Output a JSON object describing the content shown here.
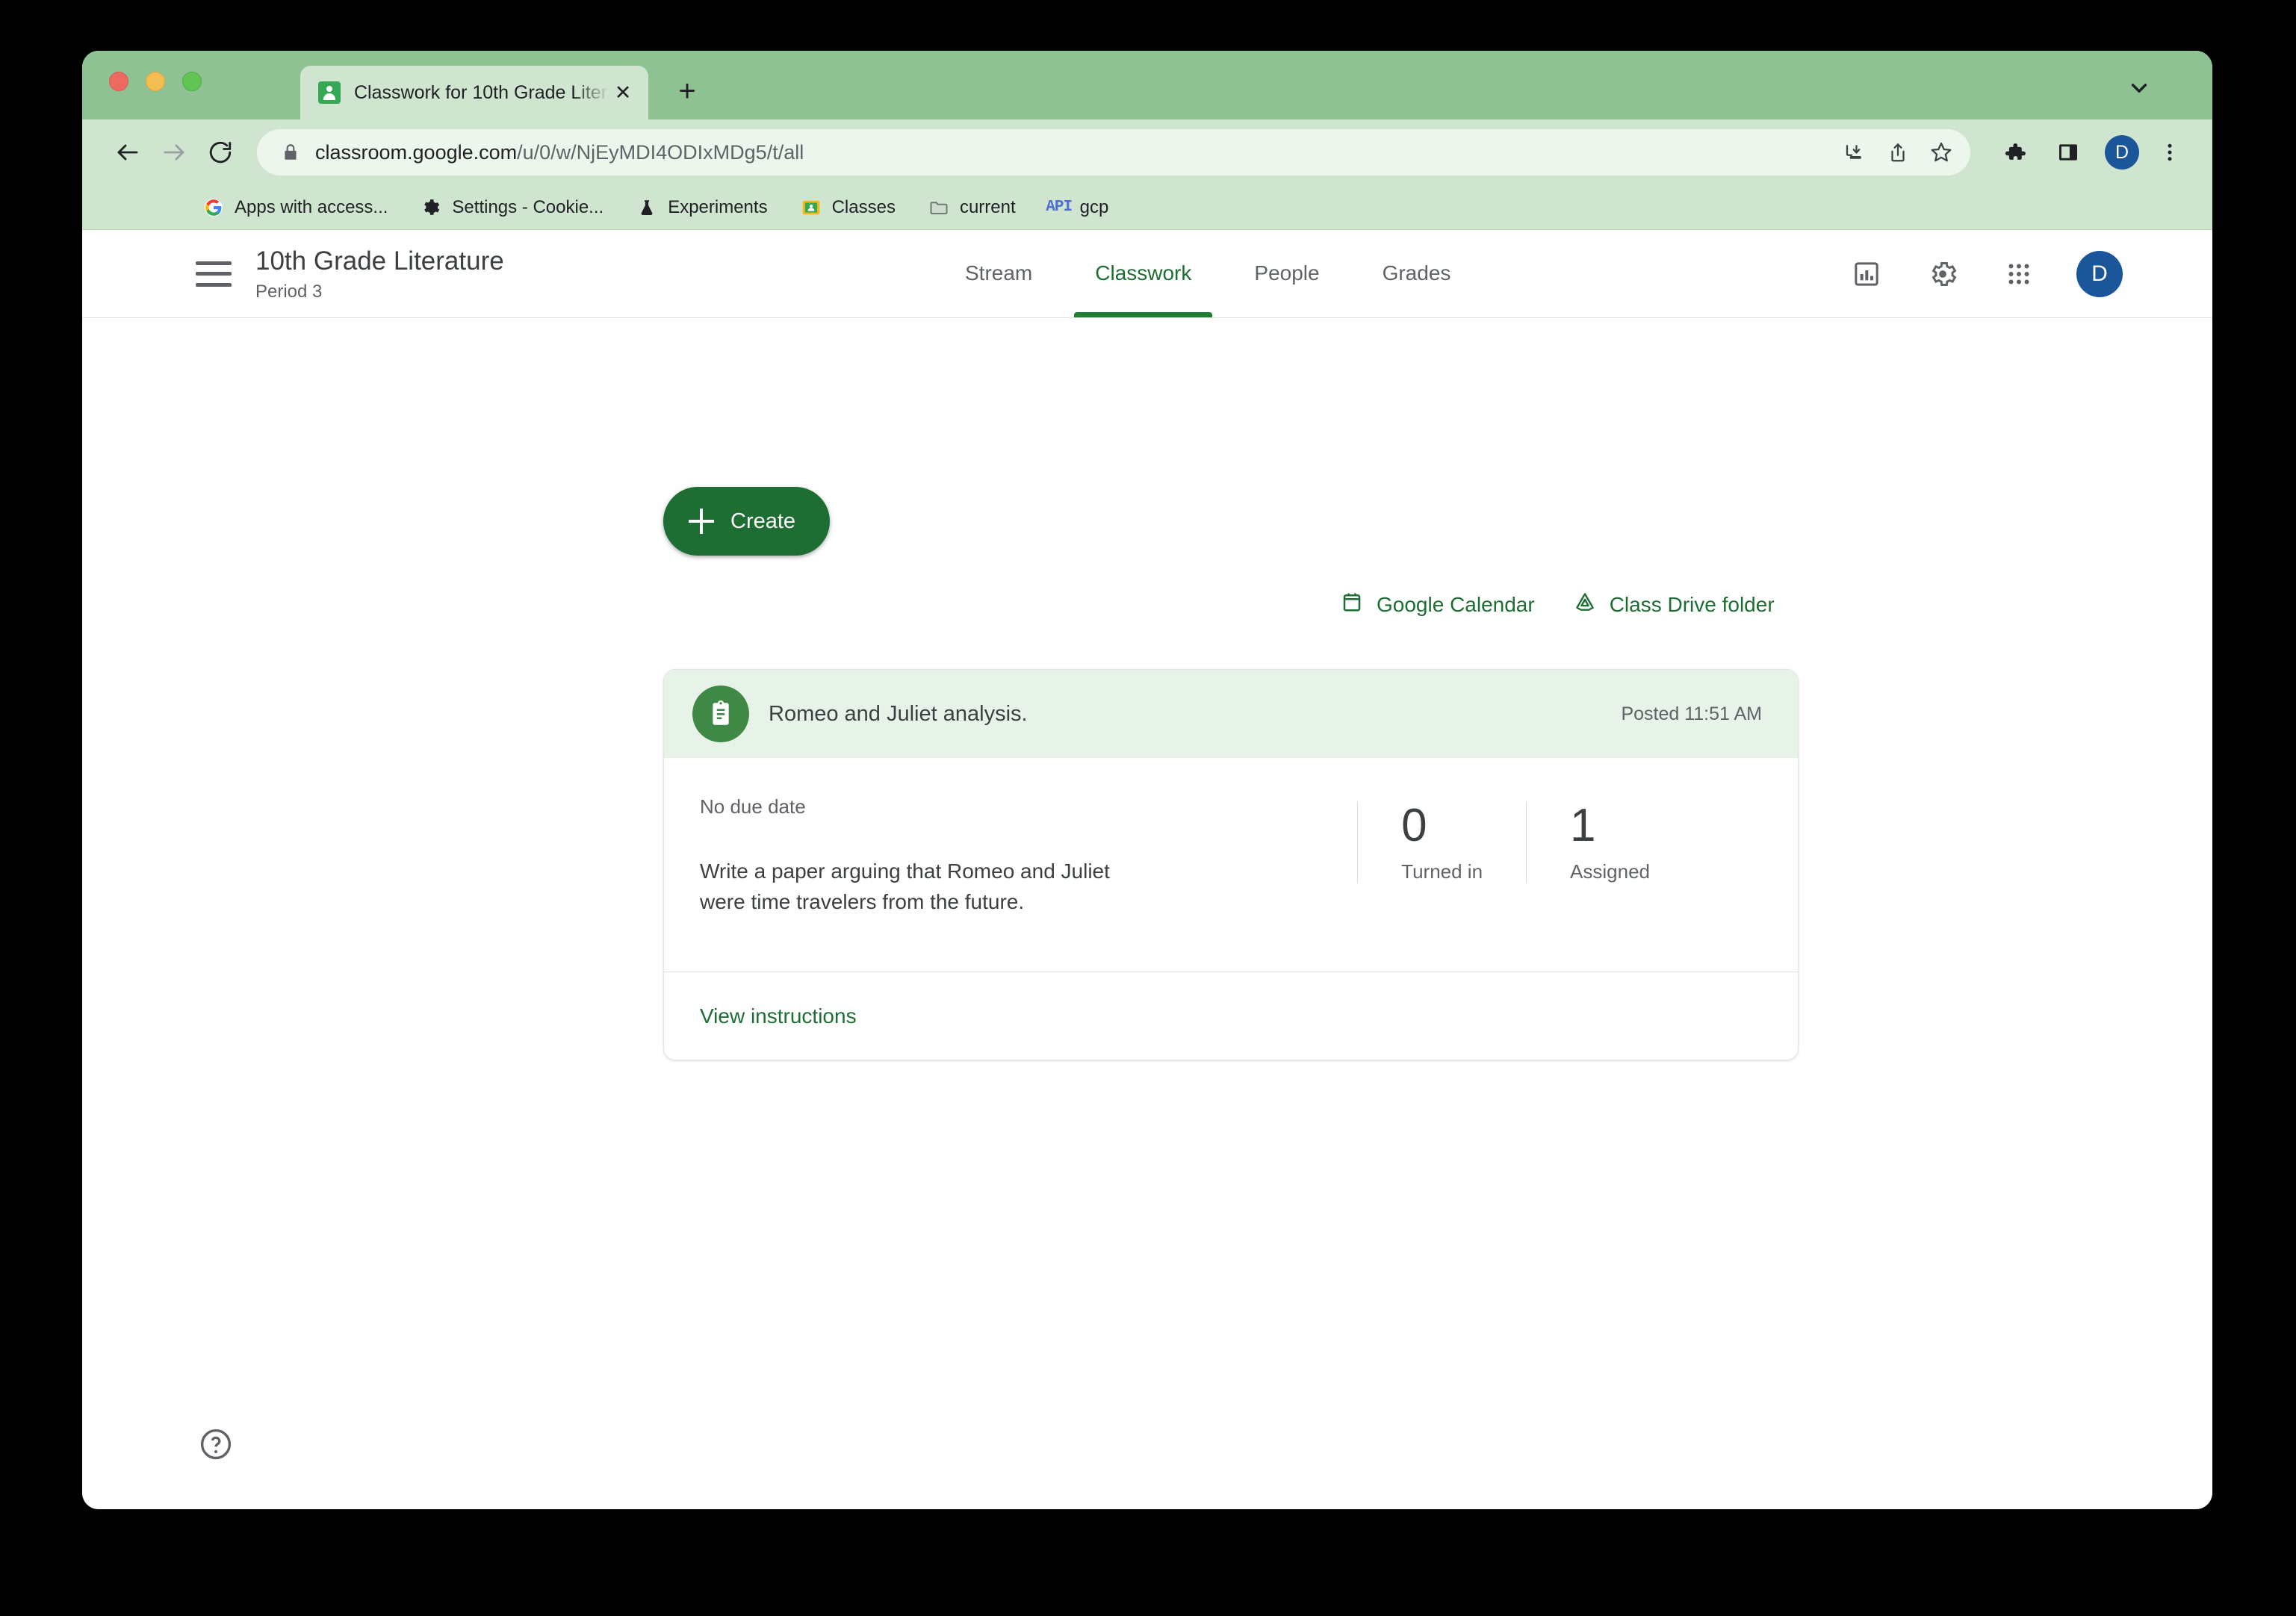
{
  "browser": {
    "tab": {
      "title": "Classwork for 10th Grade Litera",
      "favicon": "google-classroom-icon",
      "close_label": "✕"
    },
    "new_tab_label": "+",
    "omnibox": {
      "url_domain": "classroom.google.com",
      "url_path": "/u/0/w/NjEyMDI4ODIxMDg5/t/all",
      "lock_icon": "lock-icon"
    },
    "nav": {
      "back": "←",
      "forward": "→",
      "reload": "⟳"
    },
    "profile_initial": "D",
    "bookmarks": [
      {
        "label": "Apps with access...",
        "icon": "google-g-icon"
      },
      {
        "label": "Settings - Cookie...",
        "icon": "gear-icon"
      },
      {
        "label": "Experiments",
        "icon": "flask-icon"
      },
      {
        "label": "Classes",
        "icon": "classroom-icon"
      },
      {
        "label": "current",
        "icon": "folder-icon"
      },
      {
        "label": "gcp",
        "icon": "api-icon"
      }
    ]
  },
  "classroom": {
    "header": {
      "class_name": "10th Grade Literature",
      "section": "Period 3",
      "avatar_initial": "D",
      "tabs": [
        {
          "label": "Stream",
          "active": false
        },
        {
          "label": "Classwork",
          "active": true
        },
        {
          "label": "People",
          "active": false
        },
        {
          "label": "Grades",
          "active": false
        }
      ]
    },
    "toolbar": {
      "create_label": "Create",
      "google_calendar_label": "Google Calendar",
      "class_drive_label": "Class Drive folder"
    },
    "assignment": {
      "title": "Romeo and Juliet analysis.",
      "posted": "Posted 11:51 AM",
      "due_date": "No due date",
      "description": "Write a paper arguing that Romeo and Juliet were time travelers from the future.",
      "stats": [
        {
          "value": "0",
          "label": "Turned in"
        },
        {
          "value": "1",
          "label": "Assigned"
        }
      ],
      "view_instructions_label": "View instructions"
    },
    "help_label": "?"
  },
  "colors": {
    "brand_green": "#1e6e33",
    "window_chrome": "#8fc293",
    "toolbar_bg": "#cfe5cf",
    "card_header_bg": "#e7f3e8",
    "avatar_blue": "#1a5699"
  }
}
